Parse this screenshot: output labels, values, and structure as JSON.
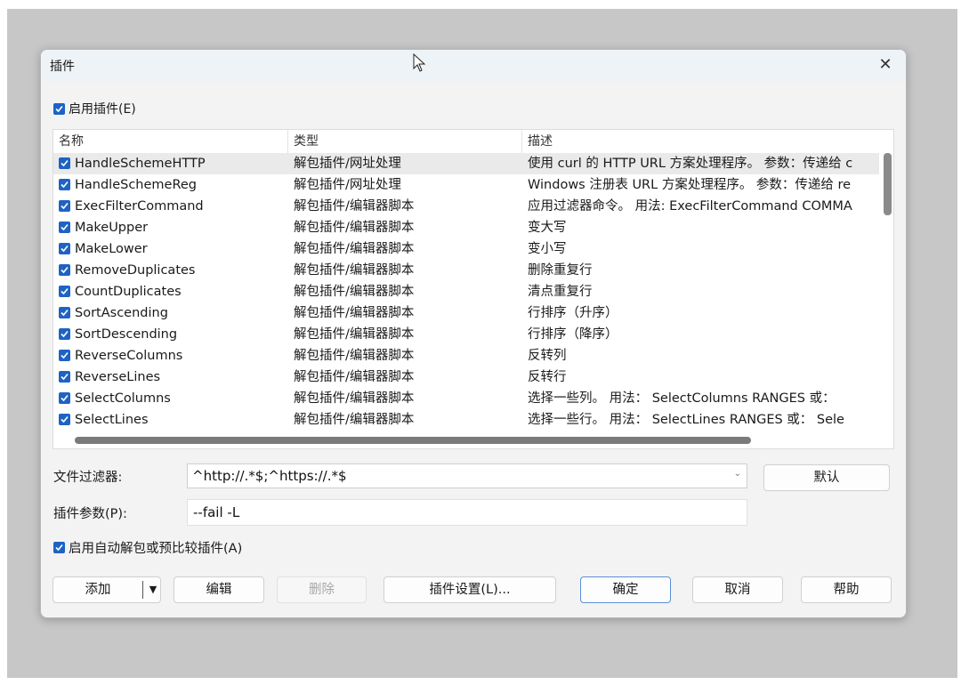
{
  "dialog": {
    "title": "插件",
    "close_glyph": "✕"
  },
  "enable_plugins": {
    "label": "启用插件(E)",
    "checked": true
  },
  "list": {
    "columns": [
      "名称",
      "类型",
      "描述"
    ],
    "rows": [
      {
        "name": "HandleSchemeHTTP",
        "type": "解包插件/网址处理",
        "desc": "使用 curl 的 HTTP URL 方案处理程序。 参数：传递给 c",
        "checked": true,
        "selected": true
      },
      {
        "name": "HandleSchemeReg",
        "type": "解包插件/网址处理",
        "desc": "Windows 注册表 URL 方案处理程序。 参数：传递给 re",
        "checked": true
      },
      {
        "name": "ExecFilterCommand",
        "type": "解包插件/编辑器脚本",
        "desc": "应用过滤器命令。 用法: ExecFilterCommand COMMA",
        "checked": true
      },
      {
        "name": "MakeUpper",
        "type": "解包插件/编辑器脚本",
        "desc": "变大写",
        "checked": true
      },
      {
        "name": "MakeLower",
        "type": "解包插件/编辑器脚本",
        "desc": "变小写",
        "checked": true
      },
      {
        "name": "RemoveDuplicates",
        "type": "解包插件/编辑器脚本",
        "desc": "删除重复行",
        "checked": true
      },
      {
        "name": "CountDuplicates",
        "type": "解包插件/编辑器脚本",
        "desc": "清点重复行",
        "checked": true
      },
      {
        "name": "SortAscending",
        "type": "解包插件/编辑器脚本",
        "desc": "行排序（升序）",
        "checked": true
      },
      {
        "name": "SortDescending",
        "type": "解包插件/编辑器脚本",
        "desc": "行排序（降序）",
        "checked": true
      },
      {
        "name": "ReverseColumns",
        "type": "解包插件/编辑器脚本",
        "desc": "反转列",
        "checked": true
      },
      {
        "name": "ReverseLines",
        "type": "解包插件/编辑器脚本",
        "desc": "反转行",
        "checked": true
      },
      {
        "name": "SelectColumns",
        "type": "解包插件/编辑器脚本",
        "desc": "选择一些列。 用法： SelectColumns RANGES   或：",
        "checked": true
      },
      {
        "name": "SelectLines",
        "type": "解包插件/编辑器脚本",
        "desc": "选择一些行。 用法： SelectLines RANGES   或： Sele",
        "checked": true
      }
    ]
  },
  "file_filter": {
    "label": "文件过滤器:",
    "value": "^http://.*$;^https://.*$",
    "default_button": "默认"
  },
  "plugin_params": {
    "label": "插件参数(P):",
    "value": "--fail -L"
  },
  "auto_unpack": {
    "label": "启用自动解包或预比较插件(A)",
    "checked": true
  },
  "buttons": {
    "add": "添加",
    "add_arrow": "▼",
    "edit": "编辑",
    "delete": "删除",
    "plugin_settings": "插件设置(L)...",
    "ok": "确定",
    "cancel": "取消",
    "help": "帮助"
  },
  "colors": {
    "accent": "#1e63c4",
    "dialog_bg": "#f3f3f3",
    "titlebar_bg": "#eef3f7",
    "backdrop": "#c7c7c7"
  }
}
